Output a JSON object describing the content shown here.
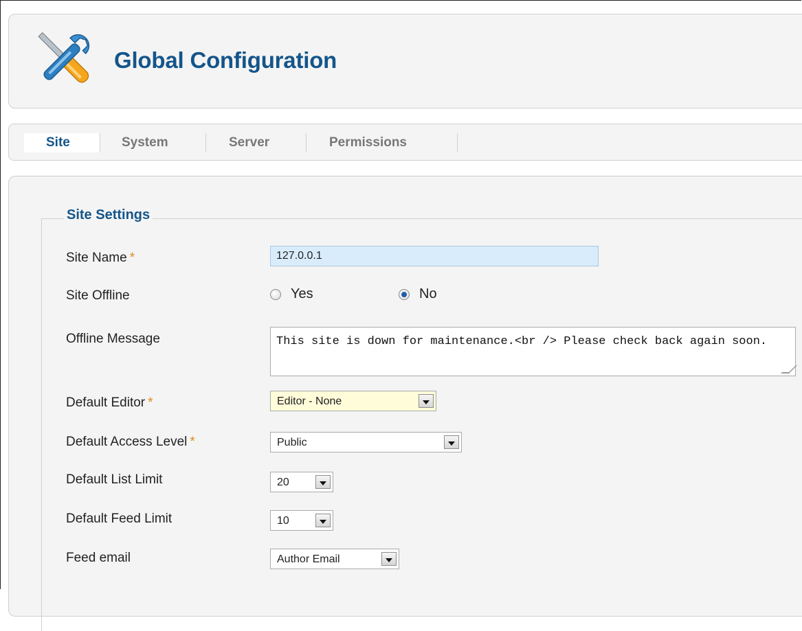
{
  "header": {
    "title": "Global Configuration",
    "icon": "tools-icon"
  },
  "tabs": [
    {
      "label": "Site",
      "active": true
    },
    {
      "label": "System",
      "active": false
    },
    {
      "label": "Server",
      "active": false
    },
    {
      "label": "Permissions",
      "active": false
    }
  ],
  "site_settings": {
    "legend": "Site Settings",
    "required_marker": "*",
    "site_name": {
      "label": "Site Name",
      "value": "127.0.0.1"
    },
    "site_offline": {
      "label": "Site Offline",
      "yes": "Yes",
      "no": "No",
      "selected": "No"
    },
    "offline_message": {
      "label": "Offline Message",
      "value": "This site is down for maintenance.<br /> Please check back again soon."
    },
    "default_editor": {
      "label": "Default Editor",
      "value": "Editor - None"
    },
    "default_access_level": {
      "label": "Default Access Level",
      "value": "Public"
    },
    "default_list_limit": {
      "label": "Default List Limit",
      "value": "20"
    },
    "default_feed_limit": {
      "label": "Default Feed Limit",
      "value": "10"
    },
    "feed_email": {
      "label": "Feed email",
      "value": "Author Email"
    }
  },
  "colors": {
    "title": "#14558a",
    "required": "#e08b1a",
    "site_name_bg": "#d9ecfb",
    "editor_bg": "#fefcd9"
  }
}
